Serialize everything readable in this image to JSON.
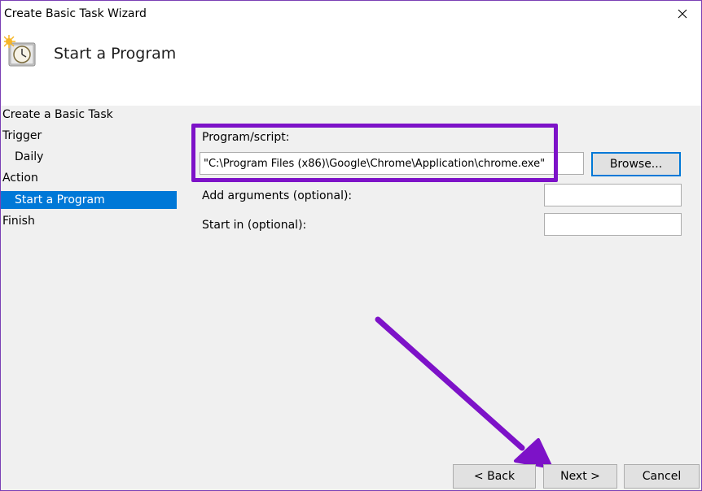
{
  "window": {
    "title": "Create Basic Task Wizard",
    "close_glyph": "✕"
  },
  "header": {
    "icon": "task-scheduler-clock-icon",
    "title": "Start a Program"
  },
  "sidebar": {
    "items": [
      {
        "label": "Create a Basic Task",
        "selected": false
      },
      {
        "label": "Trigger",
        "selected": false
      },
      {
        "label": "Daily",
        "selected": false
      },
      {
        "label": "Action",
        "selected": false
      },
      {
        "label": "Start a Program",
        "selected": true
      },
      {
        "label": "Finish",
        "selected": false
      }
    ]
  },
  "form": {
    "program_label": "Program/script:",
    "program_value": "\"C:\\Program Files (x86)\\Google\\Chrome\\Application\\chrome.exe\"",
    "browse_label": "Browse...",
    "arguments_label": "Add arguments (optional):",
    "arguments_value": "",
    "startin_label": "Start in (optional):",
    "startin_value": ""
  },
  "footer": {
    "back_label": "< Back",
    "next_label": "Next >",
    "cancel_label": "Cancel"
  },
  "colors": {
    "annotation": "#7d12c8",
    "selection": "#0078d7"
  }
}
